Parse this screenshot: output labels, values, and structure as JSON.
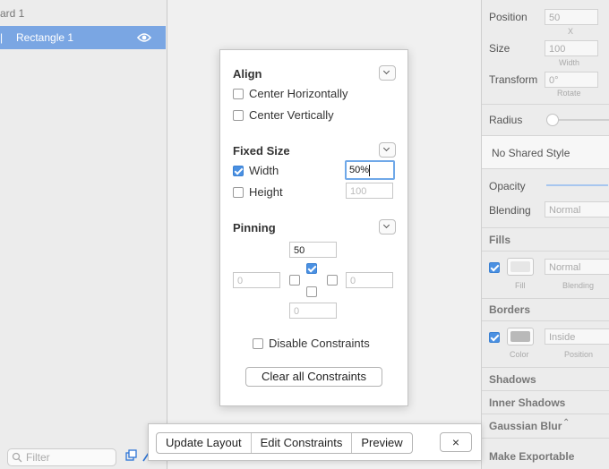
{
  "layers": {
    "artboard_label": "ard 1",
    "selected_layer_label": "Rectangle 1",
    "filter_placeholder": "Filter"
  },
  "inspector": {
    "position_label": "Position",
    "position_x": "50",
    "position_x_sub": "X",
    "size_label": "Size",
    "width_value": "100",
    "width_sub": "Width",
    "transform_label": "Transform",
    "rotate_value": "0°",
    "rotate_sub": "Rotate",
    "radius_label": "Radius",
    "shared_style": "No Shared Style",
    "opacity_label": "Opacity",
    "blending_label": "Blending",
    "blending_value": "Normal",
    "fills_header": "Fills",
    "fill_blend_value": "Normal",
    "fill_sub": "Fill",
    "fill_blend_sub": "Blending",
    "borders_header": "Borders",
    "border_position_value": "Inside",
    "border_color_sub": "Color",
    "border_position_sub": "Position",
    "shadows_header": "Shadows",
    "inner_shadows_header": "Inner Shadows",
    "gaussian_blur_header": "Gaussian Blur",
    "make_exportable": "Make Exportable"
  },
  "popover": {
    "align_title": "Align",
    "center_horizontally": "Center Horizontally",
    "center_vertically": "Center Vertically",
    "fixed_size_title": "Fixed Size",
    "width_label": "Width",
    "width_value": "50%",
    "height_label": "Height",
    "height_placeholder": "100",
    "pinning_title": "Pinning",
    "pin_top": "50",
    "pin_left": "0",
    "pin_right": "0",
    "pin_bottom": "0",
    "disable_constraints": "Disable Constraints",
    "clear_all": "Clear all Constraints"
  },
  "toolbar": {
    "update_layout": "Update Layout",
    "edit_constraints": "Edit Constraints",
    "preview": "Preview",
    "close": "×"
  },
  "colors": {
    "selection": "#7aa6e3",
    "checkbox_on": "#4a90e2",
    "fill_swatch": "#e6e6e6",
    "border_swatch": "#b9b9b9"
  }
}
